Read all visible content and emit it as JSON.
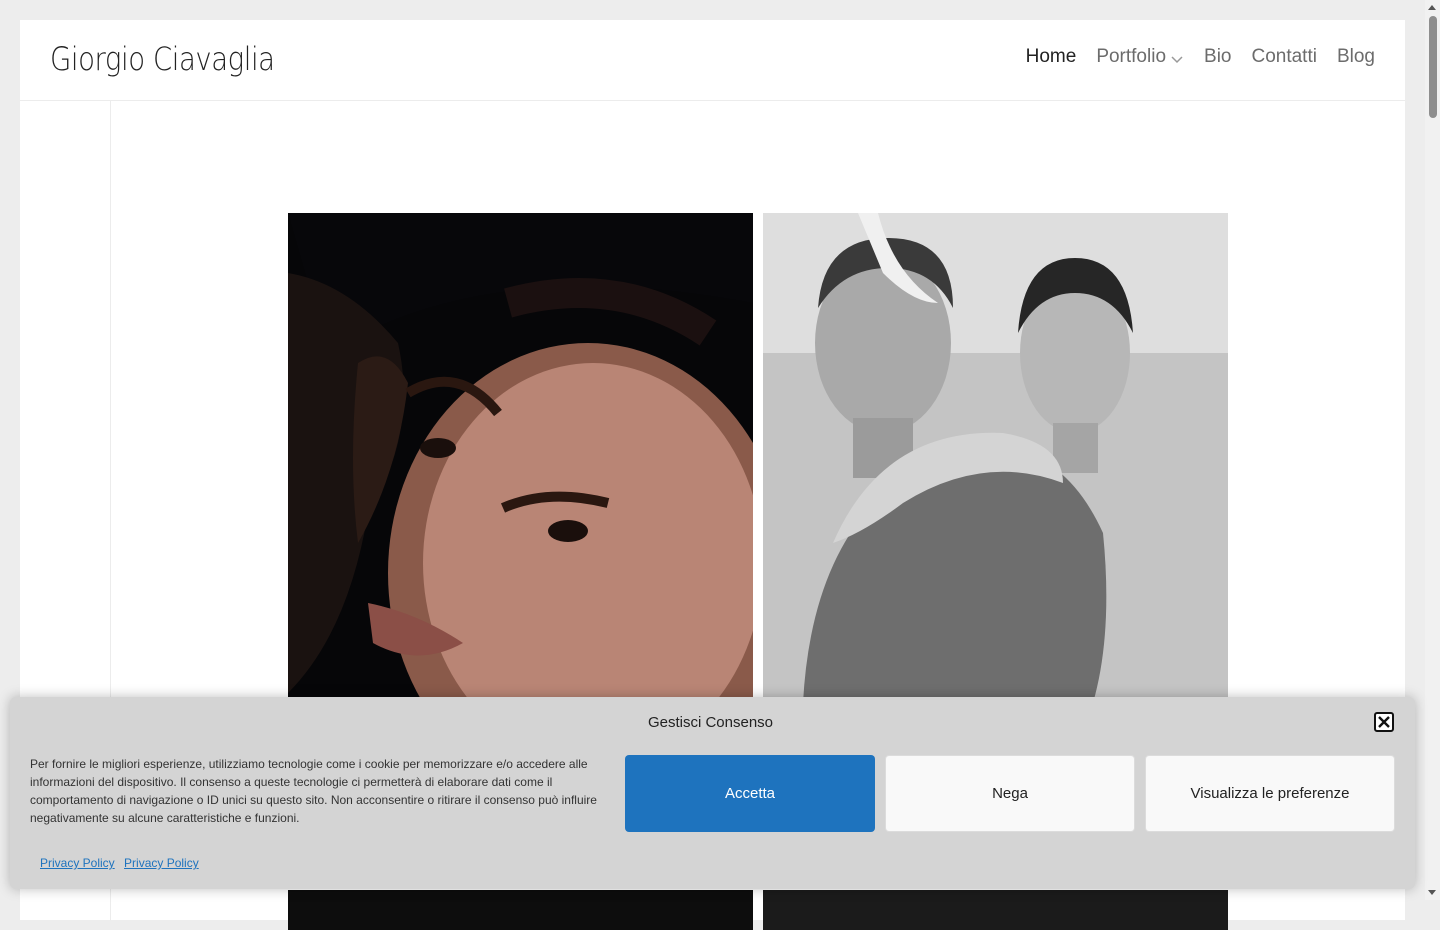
{
  "header": {
    "logo": "Giorgio Ciavaglia",
    "nav": [
      {
        "label": "Home",
        "active": true
      },
      {
        "label": "Portfolio",
        "dropdown": true
      },
      {
        "label": "Bio"
      },
      {
        "label": "Contatti"
      },
      {
        "label": "Blog"
      }
    ]
  },
  "gallery": {
    "images": [
      "portrait-woman-color",
      "portrait-bw-collage",
      "portrait-dark-bottom-left",
      "portrait-dark-bottom-right"
    ]
  },
  "consent": {
    "title": "Gestisci Consenso",
    "text": "Per fornire le migliori esperienze, utilizziamo tecnologie come i cookie per memorizzare e/o accedere alle informazioni del dispositivo. Il consenso a queste tecnologie ci permetterà di elaborare dati come il comportamento di navigazione o ID unici su questo sito. Non acconsentire o ritirare il consenso può influire negativamente su alcune caratteristiche e funzioni.",
    "accept": "Accetta",
    "deny": "Nega",
    "preferences": "Visualizza le preferenze",
    "links": [
      "Privacy Policy",
      "Privacy Policy"
    ],
    "accent_color": "#1e73be"
  }
}
